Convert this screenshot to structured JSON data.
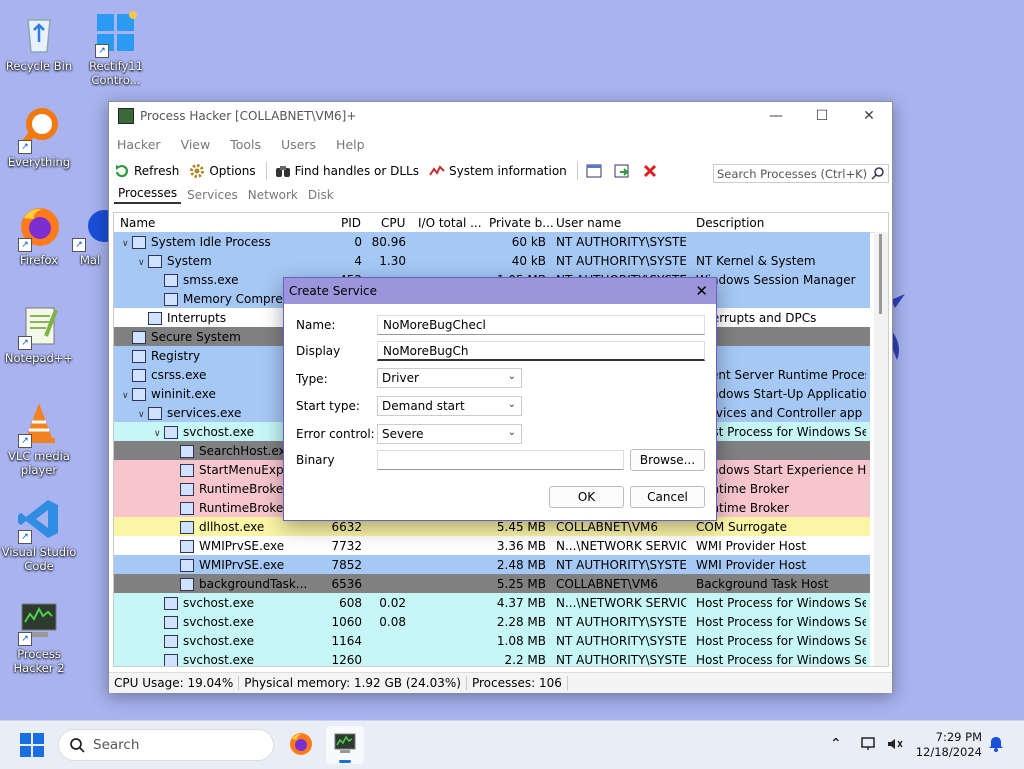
{
  "desktop": {
    "icons": [
      {
        "label": "Recycle Bin"
      },
      {
        "label": "Rectify11 Contro..."
      },
      {
        "label": "Everything"
      },
      {
        "label": "Firefox"
      },
      {
        "label": "Mal"
      },
      {
        "label": "Notepad++"
      },
      {
        "label": "VLC media player"
      },
      {
        "label": "Visual Studio Code"
      },
      {
        "label": "Process Hacker 2"
      }
    ]
  },
  "window": {
    "title": "Process Hacker [COLLABNET\\VM6]+",
    "menu": [
      "Hacker",
      "View",
      "Tools",
      "Users",
      "Help"
    ],
    "toolbar": {
      "refresh": "Refresh",
      "options": "Options",
      "find_handles": "Find handles or DLLs",
      "system_info": "System information",
      "search_placeholder": "Search Processes (Ctrl+K)"
    },
    "tabs": [
      "Processes",
      "Services",
      "Network",
      "Disk"
    ],
    "columns": [
      "Name",
      "PID",
      "CPU",
      "I/O total ...",
      "Private b...",
      "User name",
      "Description"
    ],
    "rows": [
      {
        "name": "System Idle Process",
        "pid": "0",
        "cpu": "80.96",
        "io": "",
        "priv": "60 kB",
        "user": "NT AUTHORITY\\SYSTEM",
        "desc": "",
        "bg": "#a6c8f5",
        "indent": 0,
        "arrow": "v"
      },
      {
        "name": "System",
        "pid": "4",
        "cpu": "1.30",
        "io": "",
        "priv": "40 kB",
        "user": "NT AUTHORITY\\SYSTEM",
        "desc": "NT Kernel & System",
        "bg": "#a6c8f5",
        "indent": 1,
        "arrow": "v"
      },
      {
        "name": "smss.exe",
        "pid": "452",
        "cpu": "",
        "io": "",
        "priv": "1.05 MB",
        "user": "NT AUTHORITY\\SYSTEM",
        "desc": "Windows Session Manager",
        "bg": "#a6c8f5",
        "indent": 2,
        "arrow": ""
      },
      {
        "name": "Memory Compres...",
        "pid": "",
        "cpu": "",
        "io": "",
        "priv": "",
        "user": "",
        "desc": "",
        "bg": "#a6c8f5",
        "indent": 2,
        "arrow": ""
      },
      {
        "name": "Interrupts",
        "pid": "",
        "cpu": "",
        "io": "",
        "priv": "",
        "user": "",
        "desc": "Interrupts and DPCs",
        "bg": "#ffffff",
        "indent": 1,
        "arrow": ""
      },
      {
        "name": "Secure System",
        "pid": "",
        "cpu": "",
        "io": "",
        "priv": "",
        "user": "",
        "desc": "",
        "bg": "#808080",
        "indent": 0,
        "arrow": ""
      },
      {
        "name": "Registry",
        "pid": "",
        "cpu": "",
        "io": "",
        "priv": "",
        "user": "",
        "desc": "",
        "bg": "#a6c8f5",
        "indent": 0,
        "arrow": ""
      },
      {
        "name": "csrss.exe",
        "pid": "",
        "cpu": "",
        "io": "",
        "priv": "",
        "user": "",
        "desc": "Client Server Runtime Process",
        "bg": "#a6c8f5",
        "indent": 0,
        "arrow": ""
      },
      {
        "name": "wininit.exe",
        "pid": "",
        "cpu": "",
        "io": "",
        "priv": "",
        "user": "",
        "desc": "Windows Start-Up Application",
        "bg": "#a6c8f5",
        "indent": 0,
        "arrow": "v"
      },
      {
        "name": "services.exe",
        "pid": "",
        "cpu": "",
        "io": "",
        "priv": "",
        "user": "",
        "desc": "Services and Controller app",
        "bg": "#a6c8f5",
        "indent": 1,
        "arrow": "v"
      },
      {
        "name": "svchost.exe",
        "pid": "",
        "cpu": "",
        "io": "",
        "priv": "",
        "user": "",
        "desc": "Host Process for Windows Ser...",
        "bg": "#c6f6f6",
        "indent": 2,
        "arrow": "v"
      },
      {
        "name": "SearchHost.exe",
        "pid": "",
        "cpu": "",
        "io": "",
        "priv": "",
        "user": "",
        "desc": "",
        "bg": "#808080",
        "indent": 3,
        "arrow": ""
      },
      {
        "name": "StartMenuExpe...",
        "pid": "",
        "cpu": "",
        "io": "",
        "priv": "",
        "user": "",
        "desc": "Windows Start Experience Host",
        "bg": "#f6c6cc",
        "indent": 3,
        "arrow": ""
      },
      {
        "name": "RuntimeBroker...",
        "pid": "",
        "cpu": "",
        "io": "",
        "priv": "",
        "user": "",
        "desc": "Runtime Broker",
        "bg": "#f6c6cc",
        "indent": 3,
        "arrow": ""
      },
      {
        "name": "RuntimeBroker...",
        "pid": "",
        "cpu": "",
        "io": "",
        "priv": "",
        "user": "",
        "desc": "Runtime Broker",
        "bg": "#f6c6cc",
        "indent": 3,
        "arrow": ""
      },
      {
        "name": "dllhost.exe",
        "pid": "6632",
        "cpu": "",
        "io": "",
        "priv": "5.45 MB",
        "user": "COLLABNET\\VM6",
        "desc": "COM Surrogate",
        "bg": "#fbf5a6",
        "indent": 3,
        "arrow": ""
      },
      {
        "name": "WMIPrvSE.exe",
        "pid": "7732",
        "cpu": "",
        "io": "",
        "priv": "3.36 MB",
        "user": "N...\\NETWORK SERVICE",
        "desc": "WMI Provider Host",
        "bg": "#ffffff",
        "indent": 3,
        "arrow": ""
      },
      {
        "name": "WMIPrvSE.exe",
        "pid": "7852",
        "cpu": "",
        "io": "",
        "priv": "2.48 MB",
        "user": "NT AUTHORITY\\SYSTEM",
        "desc": "WMI Provider Host",
        "bg": "#a6c8f5",
        "indent": 3,
        "arrow": ""
      },
      {
        "name": "backgroundTask...",
        "pid": "6536",
        "cpu": "",
        "io": "",
        "priv": "5.25 MB",
        "user": "COLLABNET\\VM6",
        "desc": "Background Task Host",
        "bg": "#808080",
        "indent": 3,
        "arrow": ""
      },
      {
        "name": "svchost.exe",
        "pid": "608",
        "cpu": "0.02",
        "io": "",
        "priv": "4.37 MB",
        "user": "N...\\NETWORK SERVICE",
        "desc": "Host Process for Windows Ser...",
        "bg": "#c6f6f6",
        "indent": 2,
        "arrow": ""
      },
      {
        "name": "svchost.exe",
        "pid": "1060",
        "cpu": "0.08",
        "io": "",
        "priv": "2.28 MB",
        "user": "NT AUTHORITY\\SYSTEM",
        "desc": "Host Process for Windows Ser...",
        "bg": "#c6f6f6",
        "indent": 2,
        "arrow": ""
      },
      {
        "name": "svchost.exe",
        "pid": "1164",
        "cpu": "",
        "io": "",
        "priv": "1.08 MB",
        "user": "NT AUTHORITY\\SYSTEM",
        "desc": "Host Process for Windows Ser...",
        "bg": "#c6f6f6",
        "indent": 2,
        "arrow": ""
      },
      {
        "name": "svchost.exe",
        "pid": "1260",
        "cpu": "",
        "io": "",
        "priv": "2.2 MB",
        "user": "NT AUTHORITY\\SYSTEM",
        "desc": "Host Process for Windows Ser...",
        "bg": "#c6f6f6",
        "indent": 2,
        "arrow": ""
      }
    ],
    "status": {
      "cpu": "CPU Usage: 19.04%",
      "memory": "Physical memory: 1.92 GB (24.03%)",
      "processes": "Processes: 106"
    }
  },
  "dialog": {
    "title": "Create Service",
    "name_label": "Name:",
    "name_value": "NoMoreBugChecl",
    "display_label": "Display",
    "display_value": "NoMoreBugCh",
    "type_label": "Type:",
    "type_value": "Driver",
    "start_label": "Start type:",
    "start_value": "Demand start",
    "error_label": "Error control:",
    "error_value": "Severe",
    "binary_label": "Binary",
    "binary_value": "",
    "browse": "Browse...",
    "ok": "OK",
    "cancel": "Cancel"
  },
  "taskbar": {
    "search_placeholder": "Search",
    "time": "7:29 PM",
    "date": "12/18/2024"
  }
}
